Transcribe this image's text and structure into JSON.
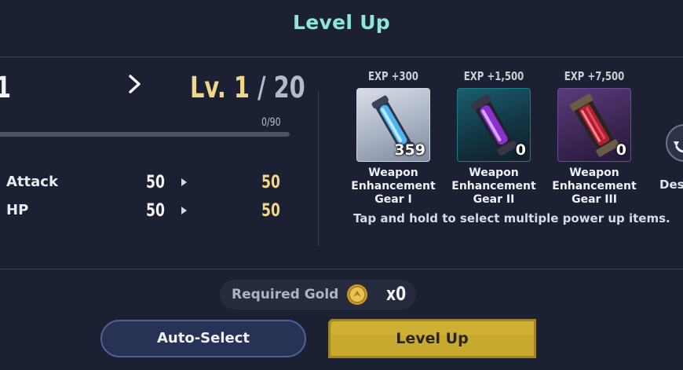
{
  "header": {
    "title": "Level Up"
  },
  "level": {
    "current": "1",
    "next_prefix": "Lv. ",
    "next": "1",
    "max_sep": " / 20",
    "exp_text": "0/90",
    "exp_progress": 0
  },
  "stats": [
    {
      "name": "Attack",
      "current": "50",
      "next": "50"
    },
    {
      "name": "HP",
      "current": "50",
      "next": "50"
    }
  ],
  "items": [
    {
      "exp": "EXP +300",
      "count": "359",
      "name_lines": [
        "Weapon",
        "Enhancement",
        "Gear I"
      ],
      "color": "#4aa8e8"
    },
    {
      "exp": "EXP +1,500",
      "count": "0",
      "name_lines": [
        "Weapon",
        "Enhancement",
        "Gear II"
      ],
      "color": "#9b3ad9"
    },
    {
      "exp": "EXP +7,500",
      "count": "0",
      "name_lines": [
        "Weapon",
        "Enhancement",
        "Gear III"
      ],
      "color": "#c2223a"
    }
  ],
  "hint": "Tap and hold to select multiple power up items.",
  "side_button": {
    "label": "Des",
    "icon": "refresh-icon"
  },
  "gold": {
    "label": "Required Gold",
    "amount": "x0",
    "icon": "gold-coin-icon"
  },
  "buttons": {
    "auto_select": "Auto-Select",
    "level_up": "Level Up"
  },
  "colors": {
    "title": "#8ee6d9",
    "gold_text": "#f0d58a",
    "level_up_button": "#c8aa2e",
    "auto_select_border": "#4d5f97"
  }
}
